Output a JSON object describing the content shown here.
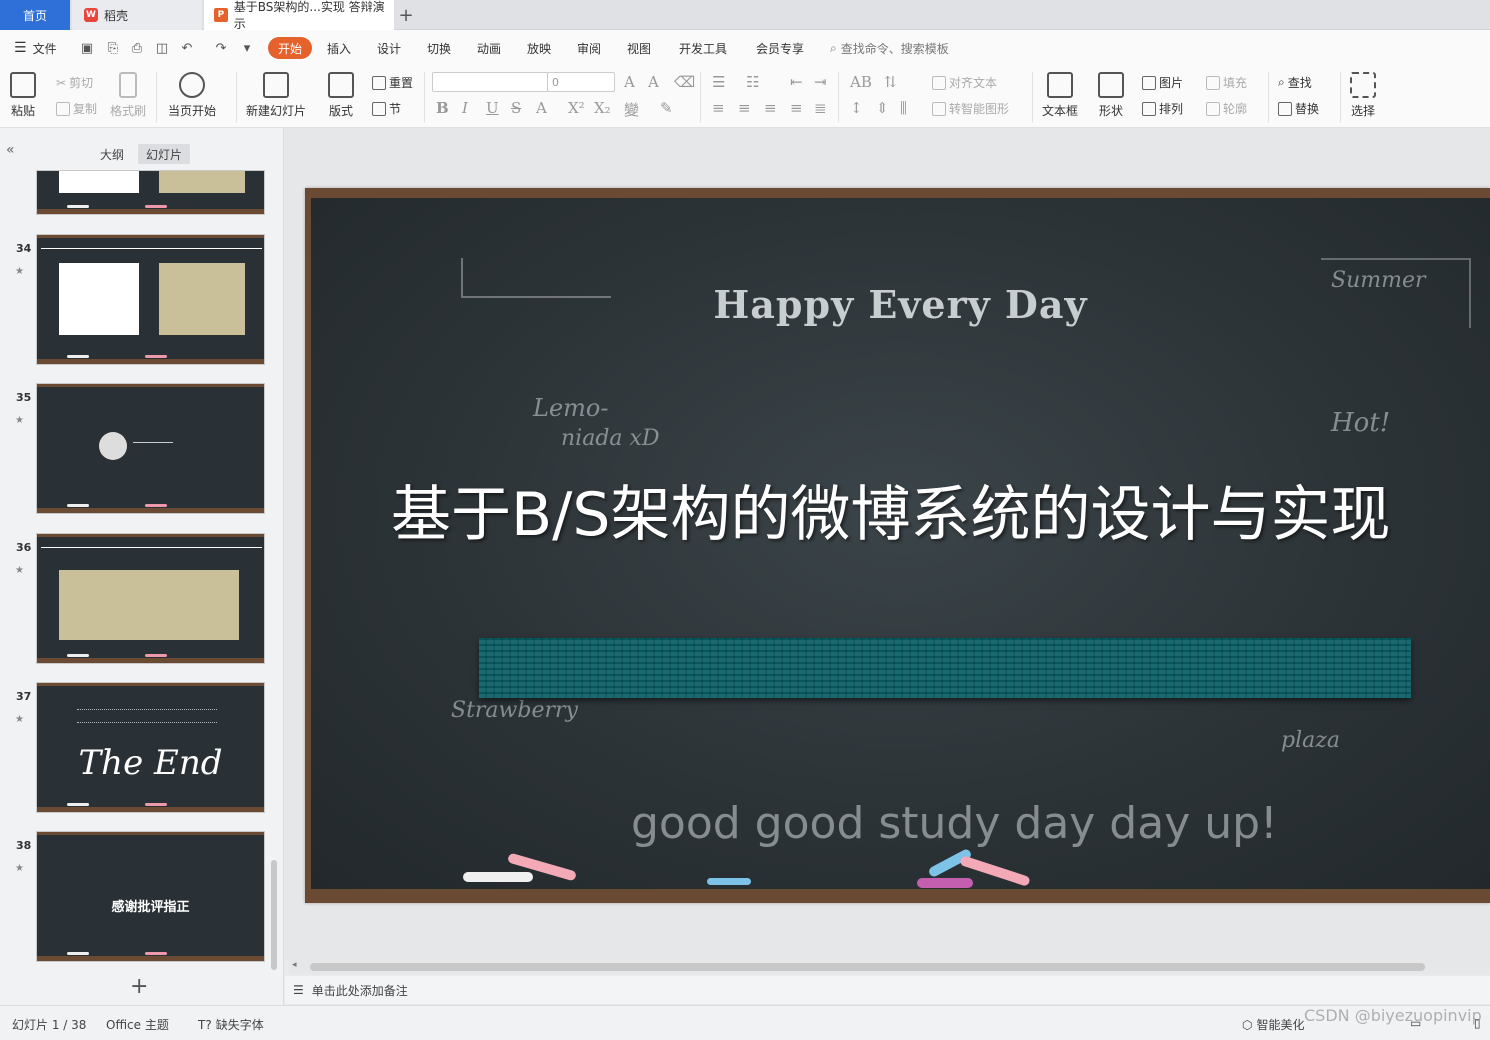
{
  "tabs": {
    "home": "首页",
    "wps": "稻壳",
    "doc": "基于BS架构的...实现 答辩演示"
  },
  "menu": {
    "file": "文件",
    "items": [
      "开始",
      "插入",
      "设计",
      "切换",
      "动画",
      "放映",
      "审阅",
      "视图",
      "开发工具",
      "会员专享"
    ],
    "search": "查找命令、搜索模板"
  },
  "ribbon": {
    "paste": "粘贴",
    "cut": "剪切",
    "copy": "复制",
    "format_painter": "格式刷",
    "from_current": "当页开始",
    "new_slide": "新建幻灯片",
    "layout": "版式",
    "reset": "重置",
    "section": "节",
    "font_size": "0",
    "align_text": "对齐文本",
    "to_smartart": "转智能图形",
    "textbox": "文本框",
    "shape": "形状",
    "picture": "图片",
    "arrange": "排列",
    "fill": "填充",
    "outline": "轮廓",
    "find": "查找",
    "replace": "替换",
    "select": "选择"
  },
  "leftpanel": {
    "outline_tab": "大纲",
    "slides_tab": "幻灯片",
    "thumbs": [
      {
        "num": "34",
        "title": ""
      },
      {
        "num": "35",
        "title": ""
      },
      {
        "num": "36",
        "title": ""
      },
      {
        "num": "37",
        "title": "The End"
      },
      {
        "num": "38",
        "title": "感谢批评指正"
      }
    ]
  },
  "slide": {
    "subtitle": "Happy Every Day",
    "title": "基于B/S架构的微博系统的设计与实现"
  },
  "notes": {
    "placeholder": "单击此处添加备注"
  },
  "statusbar": {
    "slide_count": "幻灯片 1 / 38",
    "theme": "Office 主题",
    "missing_font": "缺失字体",
    "smart": "智能美化",
    "watermark": "CSDN @biyezuopinvip"
  }
}
